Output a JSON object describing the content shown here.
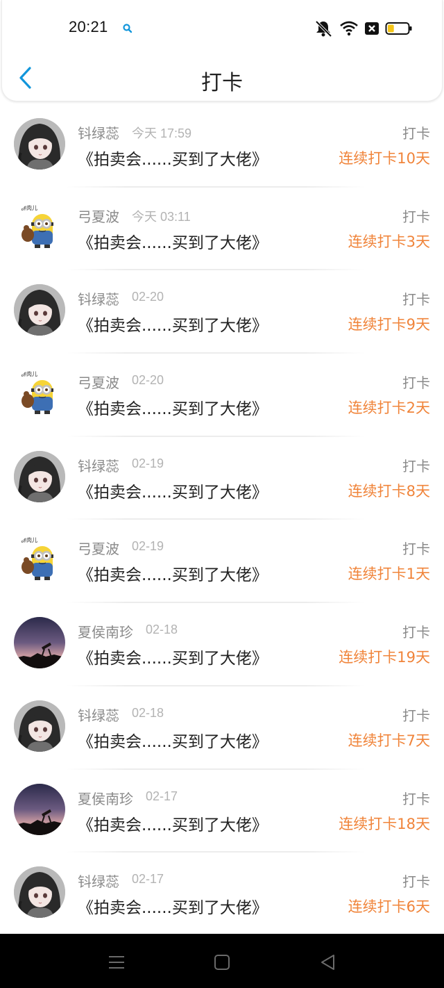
{
  "status_bar": {
    "time": "20:21",
    "icons": [
      "search-icon",
      "bell-off-icon",
      "wifi-icon",
      "sim-x-icon",
      "battery-icon"
    ],
    "battery_level": 0.3
  },
  "header": {
    "title": "打卡",
    "back_icon": "chevron-left-icon"
  },
  "colors": {
    "accent": "#1296db",
    "streak": "#f0843a",
    "name": "#8a8a8a",
    "time": "#b3b3b3"
  },
  "list": [
    {
      "name": "钭绿蕊",
      "time": "今天 17:59",
      "title": "《拍卖会......买到了大佬》",
      "tag": "打卡",
      "streak": "连续打卡10天",
      "avatar": "anime-girl"
    },
    {
      "name": "弓夏波",
      "time": "今天 03:11",
      "title": "《拍卖会......买到了大佬》",
      "tag": "打卡",
      "streak": "连续打卡3天",
      "avatar": "minion"
    },
    {
      "name": "钭绿蕊",
      "time": "02-20",
      "title": "《拍卖会......买到了大佬》",
      "tag": "打卡",
      "streak": "连续打卡9天",
      "avatar": "anime-girl"
    },
    {
      "name": "弓夏波",
      "time": "02-20",
      "title": "《拍卖会......买到了大佬》",
      "tag": "打卡",
      "streak": "连续打卡2天",
      "avatar": "minion"
    },
    {
      "name": "钭绿蕊",
      "time": "02-19",
      "title": "《拍卖会......买到了大佬》",
      "tag": "打卡",
      "streak": "连续打卡8天",
      "avatar": "anime-girl"
    },
    {
      "name": "弓夏波",
      "time": "02-19",
      "title": "《拍卖会......买到了大佬》",
      "tag": "打卡",
      "streak": "连续打卡1天",
      "avatar": "minion"
    },
    {
      "name": "夏侯南珍",
      "time": "02-18",
      "title": "《拍卖会......买到了大佬》",
      "tag": "打卡",
      "streak": "连续打卡19天",
      "avatar": "night-sky"
    },
    {
      "name": "钭绿蕊",
      "time": "02-18",
      "title": "《拍卖会......买到了大佬》",
      "tag": "打卡",
      "streak": "连续打卡7天",
      "avatar": "anime-girl"
    },
    {
      "name": "夏侯南珍",
      "time": "02-17",
      "title": "《拍卖会......买到了大佬》",
      "tag": "打卡",
      "streak": "连续打卡18天",
      "avatar": "night-sky"
    },
    {
      "name": "钭绿蕊",
      "time": "02-17",
      "title": "《拍卖会......买到了大佬》",
      "tag": "打卡",
      "streak": "连续打卡6天",
      "avatar": "anime-girl"
    }
  ],
  "nav_bar": {
    "buttons": [
      "menu-icon",
      "home-square-icon",
      "back-triangle-icon"
    ]
  }
}
